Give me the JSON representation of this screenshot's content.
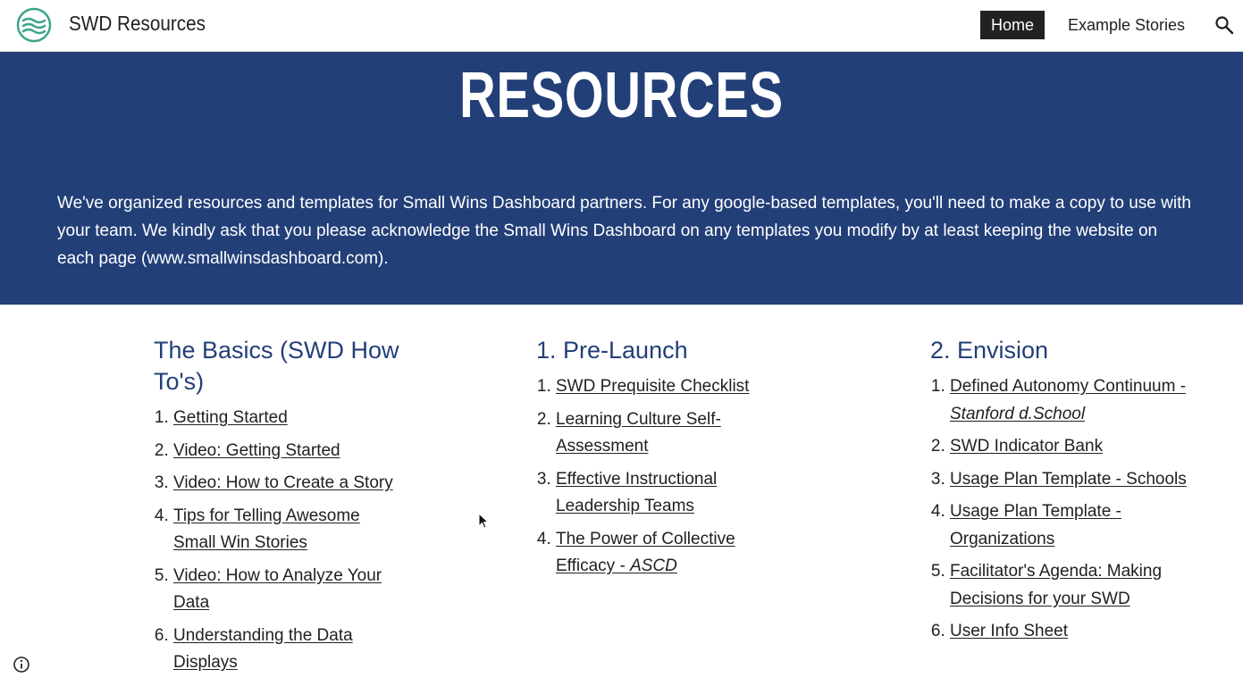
{
  "header": {
    "site_title": "SWD Resources",
    "nav": [
      "Home",
      "Example Stories"
    ],
    "icons": {
      "logo": "waves-logo-icon",
      "search": "search-icon"
    }
  },
  "hero": {
    "title": "RESOURCES",
    "text": "We've organized resources and templates for Small Wins Dashboard partners. For any google-based templates, you'll need to make a copy to use with your team. We kindly ask that you please acknowledge the Small Wins Dashboard on any templates you modify by at least keeping the website on each page (www.smallwinsdashboard.com)."
  },
  "sections": [
    {
      "heading": "The Basics (SWD How To's)",
      "items": [
        {
          "text": "Getting Started"
        },
        {
          "text": "Video: Getting Started"
        },
        {
          "text": "Video: How to Create a Story"
        },
        {
          "text": "Tips for Telling Awesome Small Win Stories"
        },
        {
          "text": "Video: How to Analyze Your Data"
        },
        {
          "text": "Understanding the Data Displays"
        }
      ]
    },
    {
      "heading": "1. Pre-Launch",
      "items": [
        {
          "text": "SWD Prequisite Checklist"
        },
        {
          "text": "Learning Culture Self-Assessment"
        },
        {
          "text": "Effective Instructional Leadership Teams"
        },
        {
          "text": "The Power of Collective Efficacy - ",
          "source": "ASCD"
        }
      ]
    },
    {
      "heading": "2. Envision",
      "items": [
        {
          "text": "Defined Autonomy Continuum - ",
          "source": "Stanford d.School"
        },
        {
          "text": "SWD Indicator Bank"
        },
        {
          "text": "Usage Plan Template - Schools"
        },
        {
          "text": "Usage Plan Template - Organizations"
        },
        {
          "text": "Facilitator's Agenda: Making Decisions for your SWD"
        },
        {
          "text": "User Info Sheet"
        }
      ]
    }
  ],
  "footer": {
    "icons": {
      "info": "info-icon"
    }
  }
}
